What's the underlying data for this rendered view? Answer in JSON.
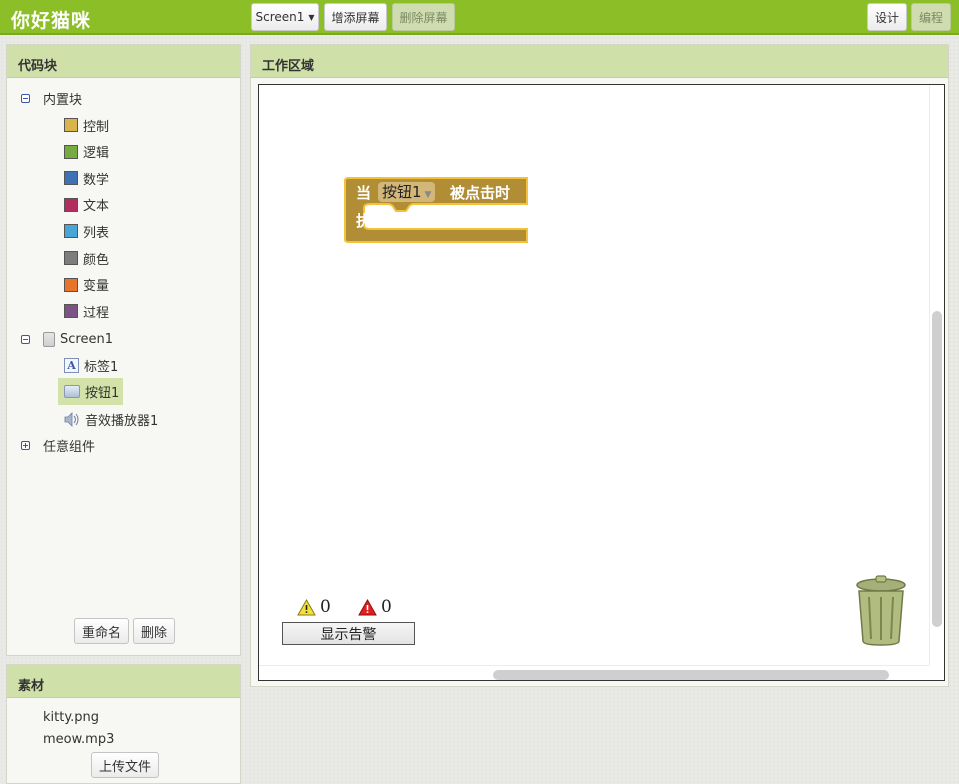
{
  "app": {
    "title": "你好猫咪"
  },
  "toolbar": {
    "screen_select": "Screen1",
    "add_screen": "增添屏幕",
    "remove_screen": "删除屏幕",
    "designer": "设计",
    "blocks": "编程"
  },
  "blocks_panel": {
    "title": "代码块",
    "builtin": {
      "label": "内置块",
      "items": [
        {
          "label": "控制",
          "color": "#d9b44a"
        },
        {
          "label": "逻辑",
          "color": "#77ab41"
        },
        {
          "label": "数学",
          "color": "#3f71b5"
        },
        {
          "label": "文本",
          "color": "#b32d5e"
        },
        {
          "label": "列表",
          "color": "#49a6d4"
        },
        {
          "label": "颜色",
          "color": "#7d7d7d"
        },
        {
          "label": "变量",
          "color": "#e8732b"
        },
        {
          "label": "过程",
          "color": "#7c5385"
        }
      ]
    },
    "screen": {
      "label": "Screen1",
      "children": [
        "标签1",
        "按钮1",
        "音效播放器1"
      ]
    },
    "any_component": "任意组件",
    "rename_button": "重命名",
    "delete_button": "删除"
  },
  "media_panel": {
    "title": "素材",
    "files": [
      "kitty.png",
      "meow.mp3"
    ],
    "upload_button": "上传文件"
  },
  "workspace": {
    "title": "工作区域",
    "event_block": {
      "when": "当",
      "component": "按钮1",
      "event": "被点击时",
      "do": "执行",
      "color": "#b18e35"
    },
    "warnings_count": "0",
    "errors_count": "0",
    "show_warnings_button": "显示告警"
  }
}
